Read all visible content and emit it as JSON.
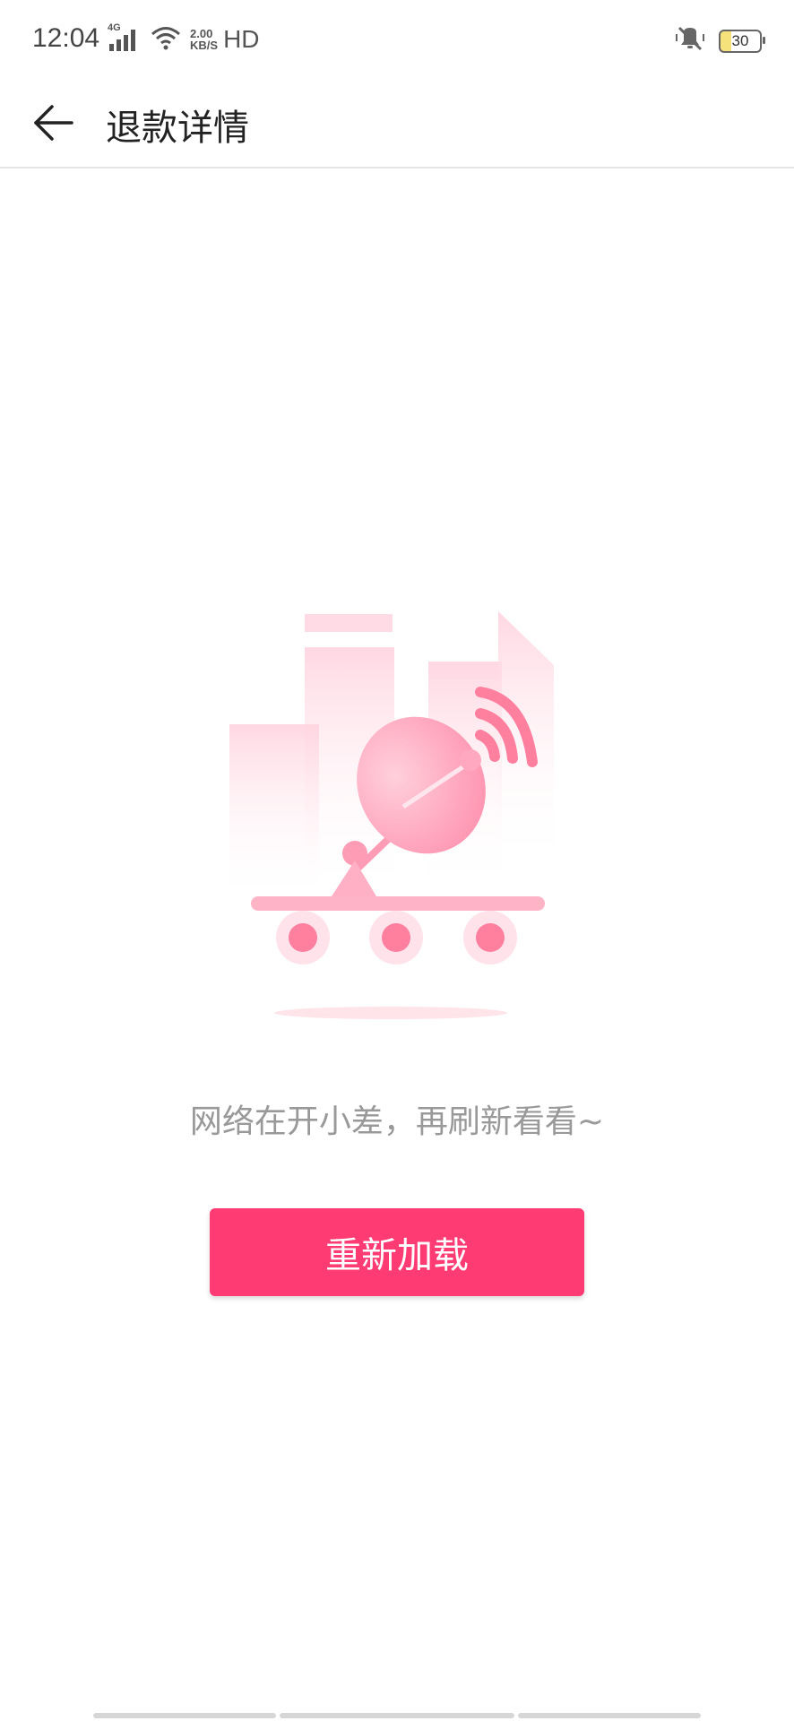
{
  "status_bar": {
    "time": "12:04",
    "network": "4G",
    "speed_value": "2.00",
    "speed_unit": "KB/S",
    "hd": "HD",
    "battery": "30"
  },
  "header": {
    "title": "退款详情"
  },
  "main": {
    "error_message": "网络在开小差，再刷新看看~",
    "reload_button": "重新加载"
  },
  "colors": {
    "accent": "#ff3b74",
    "illustration_pink": "#ffb3c6"
  }
}
